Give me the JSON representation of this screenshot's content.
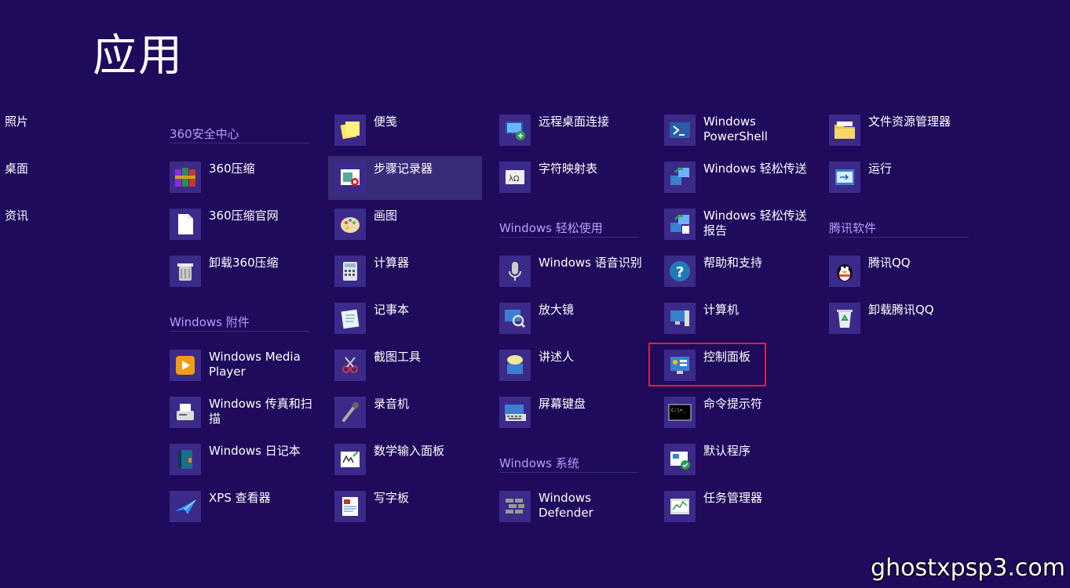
{
  "page_title": "应用",
  "left_nav": [
    "照片",
    "桌面",
    "资讯"
  ],
  "columns": [
    {
      "items": [
        {
          "type": "header",
          "text": "360安全中心"
        },
        {
          "type": "app",
          "label": "360压缩",
          "icon": "winrar-books-icon"
        },
        {
          "type": "app",
          "label": "360压缩官网",
          "icon": "blank-document-icon"
        },
        {
          "type": "app",
          "label": "卸载360压缩",
          "icon": "uninstall-bin-icon"
        },
        {
          "type": "header",
          "text": "Windows 附件"
        },
        {
          "type": "app",
          "label": "Windows Media Player",
          "icon": "media-player-icon"
        },
        {
          "type": "app",
          "label": "Windows 传真和扫描",
          "icon": "fax-icon"
        },
        {
          "type": "app",
          "label": "Windows 日记本",
          "icon": "journal-icon"
        },
        {
          "type": "app",
          "label": "XPS 查看器",
          "icon": "xps-viewer-icon"
        }
      ]
    },
    {
      "items": [
        {
          "type": "app",
          "label": "便笺",
          "icon": "sticky-notes-icon"
        },
        {
          "type": "app",
          "label": "步骤记录器",
          "icon": "steps-recorder-icon",
          "selected": true
        },
        {
          "type": "app",
          "label": "画图",
          "icon": "paint-palette-icon"
        },
        {
          "type": "app",
          "label": "计算器",
          "icon": "calculator-icon"
        },
        {
          "type": "app",
          "label": "记事本",
          "icon": "notepad-icon"
        },
        {
          "type": "app",
          "label": "截图工具",
          "icon": "snipping-tool-icon"
        },
        {
          "type": "app",
          "label": "录音机",
          "icon": "microphone-icon"
        },
        {
          "type": "app",
          "label": "数学输入面板",
          "icon": "math-input-icon"
        },
        {
          "type": "app",
          "label": "写字板",
          "icon": "wordpad-icon"
        }
      ]
    },
    {
      "items": [
        {
          "type": "app",
          "label": "远程桌面连接",
          "icon": "remote-desktop-icon"
        },
        {
          "type": "app",
          "label": "字符映射表",
          "icon": "character-map-icon"
        },
        {
          "type": "header",
          "text": "Windows 轻松使用"
        },
        {
          "type": "app",
          "label": "Windows 语音识别",
          "icon": "speech-recognition-icon"
        },
        {
          "type": "app",
          "label": "放大镜",
          "icon": "magnifier-icon"
        },
        {
          "type": "app",
          "label": "讲述人",
          "icon": "narrator-icon"
        },
        {
          "type": "app",
          "label": "屏幕键盘",
          "icon": "on-screen-keyboard-icon"
        },
        {
          "type": "header",
          "text": "Windows 系统"
        },
        {
          "type": "app",
          "label": "Windows Defender",
          "icon": "defender-wall-icon"
        }
      ]
    },
    {
      "items": [
        {
          "type": "app",
          "label": "Windows PowerShell",
          "icon": "powershell-icon"
        },
        {
          "type": "app",
          "label": "Windows 轻松传送",
          "icon": "easy-transfer-icon"
        },
        {
          "type": "app",
          "label": "Windows 轻松传送报告",
          "icon": "easy-transfer-report-icon"
        },
        {
          "type": "app",
          "label": "帮助和支持",
          "icon": "help-question-icon"
        },
        {
          "type": "app",
          "label": "计算机",
          "icon": "computer-icon"
        },
        {
          "type": "app",
          "label": "控制面板",
          "icon": "control-panel-icon",
          "highlighted": true
        },
        {
          "type": "app",
          "label": "命令提示符",
          "icon": "command-prompt-icon"
        },
        {
          "type": "app",
          "label": "默认程序",
          "icon": "default-programs-icon"
        },
        {
          "type": "app",
          "label": "任务管理器",
          "icon": "task-manager-icon"
        }
      ]
    },
    {
      "items": [
        {
          "type": "app",
          "label": "文件资源管理器",
          "icon": "file-explorer-icon"
        },
        {
          "type": "app",
          "label": "运行",
          "icon": "run-dialog-icon"
        },
        {
          "type": "header",
          "text": "腾讯软件"
        },
        {
          "type": "app",
          "label": "腾讯QQ",
          "icon": "qq-penguin-icon"
        },
        {
          "type": "app",
          "label": "卸载腾讯QQ",
          "icon": "recycle-bin-icon"
        }
      ]
    }
  ],
  "watermark": "ghostxpsp3.com",
  "colors": {
    "background": "#1f0a5c",
    "group_header": "#b99cff",
    "tile_icon_bg": "#3c2a8a",
    "selected_bg": "#3a2a7a",
    "highlight_border": "#e02030"
  }
}
